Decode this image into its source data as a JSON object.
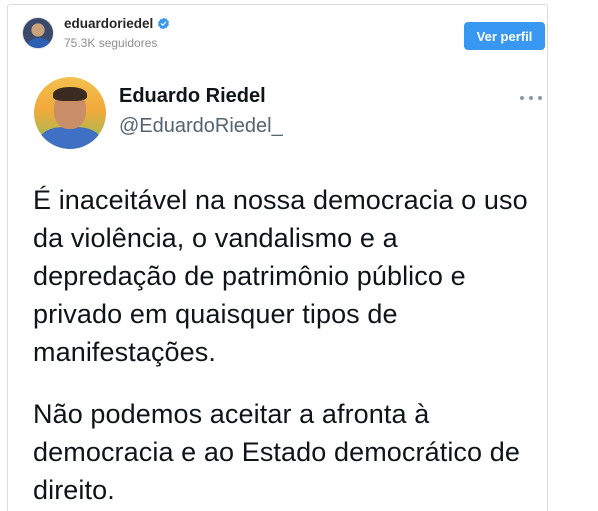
{
  "instagram_header": {
    "username": "eduardoriedel",
    "followers": "75.3K seguidores",
    "profile_button": "Ver perfil"
  },
  "tweet": {
    "name": "Eduardo Riedel",
    "handle": "@EduardoRiedel_",
    "paragraph_1": "É inaceitável na nossa democracia o uso da violência, o vandalismo e a depredação de patrimônio público e privado em quaisquer tipos de manifestações.",
    "paragraph_2": "Não podemos aceitar a afronta à democracia e ao Estado democrático de direito."
  },
  "colors": {
    "profile_button": "#3897f0",
    "verified_badge": "#3897f0",
    "tweet_text": "#0f1419",
    "handle_text": "#536471"
  }
}
